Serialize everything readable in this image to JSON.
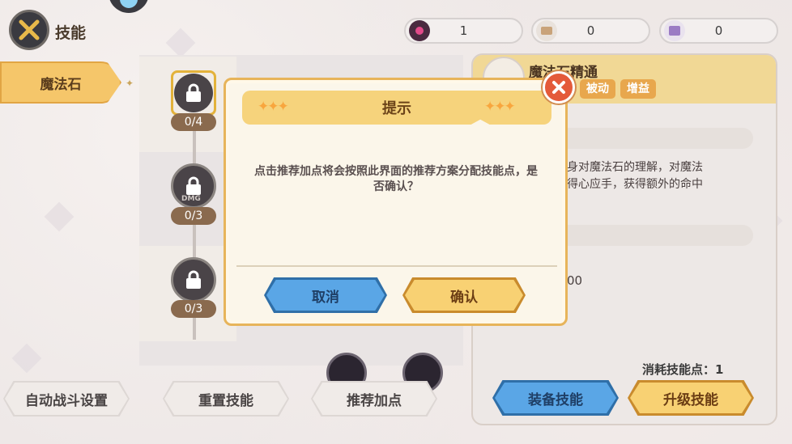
{
  "header": {
    "title": "技能",
    "currencies": [
      {
        "icon": "magic-orb-icon",
        "value": "1"
      },
      {
        "icon": "scroll-icon",
        "value": "0"
      },
      {
        "icon": "book-icon",
        "value": "0"
      }
    ]
  },
  "sidebar": {
    "tab_label": "魔法石"
  },
  "tree": {
    "levels": [
      "0/4",
      "0/3",
      "0/3"
    ],
    "node_badge": "DMG"
  },
  "detail": {
    "skill_name": "魔法石精通",
    "tags": [
      "被动",
      "增益"
    ],
    "desc_line1": "身对魔法石的理解，对魔法",
    "desc_line2": "得心应手，获得额外的命中",
    "partial_value": "00",
    "cost_label": "消耗技能点：1"
  },
  "buttons": {
    "auto_battle": "自动战斗设置",
    "reset": "重置技能",
    "recommend": "推荐加点",
    "equip": "装备技能",
    "upgrade": "升级技能"
  },
  "dialog": {
    "title": "提示",
    "message": "点击推荐加点将会按照此界面的推荐方案分配技能点，是否确认？",
    "cancel": "取消",
    "confirm": "确认"
  },
  "colors": {
    "accent_gold": "#f6d37c",
    "blue_button": "#5aa6e6",
    "yellow_button": "#f8d173",
    "close_red": "#e45a3a"
  }
}
